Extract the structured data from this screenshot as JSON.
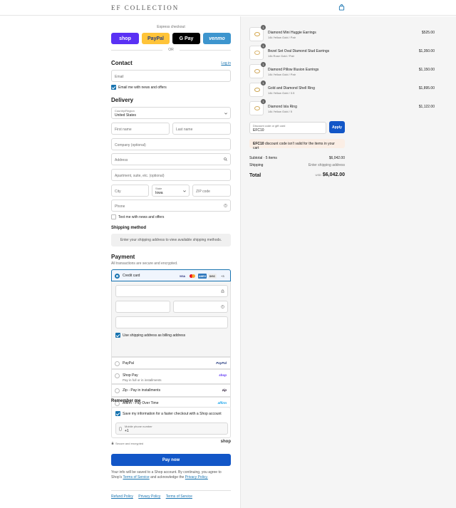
{
  "header": {
    "logo": "EF COLLECTION",
    "cart_icon": "shopping-bag-icon"
  },
  "express": {
    "label": "Express checkout",
    "buttons": [
      {
        "label": "shop",
        "bg": "#5a31f4",
        "fg": "#ffffff"
      },
      {
        "label": "PayPal",
        "bg": "#ffc439",
        "fg": "#253b80"
      },
      {
        "label": "G Pay",
        "bg": "#000000",
        "fg": "#ffffff"
      },
      {
        "label": "venmo",
        "bg": "#3d95ce",
        "fg": "#ffffff"
      }
    ],
    "or": "OR"
  },
  "contact": {
    "title": "Contact",
    "login": "Log in",
    "email_placeholder": "Email",
    "email_news": "Email me with news and offers"
  },
  "delivery": {
    "title": "Delivery",
    "country_label": "Country/Region",
    "country_value": "United States",
    "first_name": "First name",
    "last_name": "Last name",
    "company": "Company (optional)",
    "address": "Address",
    "apartment": "Apartment, suite, etc. (optional)",
    "city": "City",
    "state_label": "State",
    "state_value": "Iowa",
    "zip": "ZIP code",
    "phone": "Phone",
    "text_news": "Text me with news and offers"
  },
  "shipping_method": {
    "title": "Shipping method",
    "message": "Enter your shipping address to view available shipping methods."
  },
  "payment": {
    "title": "Payment",
    "subtitle": "All transactions are secure and encrypted.",
    "credit_card": "Credit card",
    "card_brands": [
      "VISA",
      "MC",
      "AMEX",
      "DISC"
    ],
    "more_cards": "+3",
    "use_shipping": "Use shipping address as billing address",
    "options": [
      {
        "label": "PayPal",
        "sub": "",
        "brand": "PayPal"
      },
      {
        "label": "Shop Pay",
        "sub": "Pay in full or in installments",
        "brand": "shop"
      },
      {
        "label": "Zip - Pay in installments",
        "sub": "",
        "brand": "zip"
      },
      {
        "label": "Affirm - Pay Over Time",
        "sub": "",
        "brand": "affirm"
      }
    ]
  },
  "remember": {
    "title": "Remember me",
    "save_info": "Save my information for a faster checkout with a Shop account",
    "phone_label": "Mobile phone number",
    "phone_value": "+1",
    "secure": "Secure and encrypted",
    "shop_brand": "shop"
  },
  "pay_now": "Pay now",
  "legal": {
    "text_before": "Your info will be saved to a Shop account. By continuing, you agree to Shop's",
    "terms": "Terms of Service",
    "text_mid": "and acknowledge the",
    "privacy": "Privacy Policy."
  },
  "footer": [
    "Refund Policy",
    "Privacy Policy",
    "Terms of Service"
  ],
  "order": {
    "items": [
      {
        "name": "Diamond Mini Huggie Earrings",
        "variant": "14k Yellow Gold / Pair",
        "price": "$525.00",
        "qty": "1"
      },
      {
        "name": "Bezel Set Oval Diamond Stud Earrings",
        "variant": "14k Rose Gold / Pair",
        "price": "$1,350.00",
        "qty": "1"
      },
      {
        "name": "Diamond Pillow Illusion Earrings",
        "variant": "14k Yellow Gold / Pair",
        "price": "$1,150.00",
        "qty": "1"
      },
      {
        "name": "Gold and Diamond Shell Ring",
        "variant": "14k Yellow Gold / 3.5",
        "price": "$1,895.00",
        "qty": "1"
      },
      {
        "name": "Diamond Isla Ring",
        "variant": "14k Yellow Gold / 5",
        "price": "$1,122.00",
        "qty": "1"
      }
    ],
    "discount_label": "Discount code or gift card",
    "discount_value": "EFC10",
    "apply": "Apply",
    "error_code": "EFC10",
    "error_text": "discount code isn't valid for the items in your cart",
    "subtotal_label": "Subtotal · 5 items",
    "subtotal_value": "$6,042.00",
    "shipping_label": "Shipping",
    "shipping_value": "Enter shipping address",
    "total_label": "Total",
    "currency": "USD",
    "total_value": "$6,042.00"
  }
}
